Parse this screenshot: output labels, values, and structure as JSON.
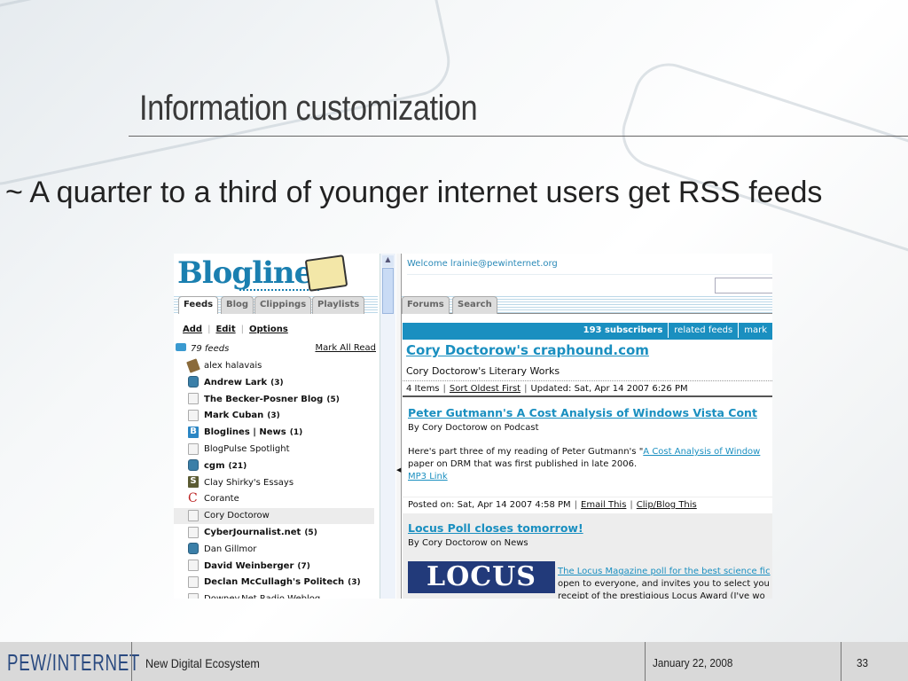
{
  "slide": {
    "title": "Information customization",
    "bullet": "~ A quarter to a third of younger internet users get RSS feeds"
  },
  "bloglines": {
    "logo": "Bloglines",
    "left_tabs": [
      "Feeds",
      "Blog",
      "Clippings",
      "Playlists"
    ],
    "actions": [
      "Add",
      "Edit",
      "Options"
    ],
    "feed_count": "79 feeds",
    "mark_all_read": "Mark All Read",
    "feeds": [
      {
        "name": "alex halavais",
        "count": "",
        "icon": "avatar",
        "bold": false
      },
      {
        "name": "Andrew Lark",
        "count": "(3)",
        "icon": "bubble",
        "bold": true
      },
      {
        "name": "The Becker-Posner Blog",
        "count": "(5)",
        "icon": "page",
        "bold": true
      },
      {
        "name": "Mark Cuban",
        "count": "(3)",
        "icon": "page",
        "bold": true
      },
      {
        "name": "Bloglines | News",
        "count": "(1)",
        "icon": "b",
        "bold": true
      },
      {
        "name": "BlogPulse Spotlight",
        "count": "",
        "icon": "page",
        "bold": false
      },
      {
        "name": "cgm",
        "count": "(21)",
        "icon": "bubble",
        "bold": true
      },
      {
        "name": "Clay Shirky's Essays",
        "count": "",
        "icon": "s",
        "bold": false
      },
      {
        "name": "Corante",
        "count": "",
        "icon": "c",
        "bold": false
      },
      {
        "name": "Cory Doctorow",
        "count": "",
        "icon": "page",
        "bold": false,
        "selected": true
      },
      {
        "name": "CyberJournalist.net",
        "count": "(5)",
        "icon": "page",
        "bold": true
      },
      {
        "name": "Dan Gillmor",
        "count": "",
        "icon": "bubble",
        "bold": false
      },
      {
        "name": "David Weinberger",
        "count": "(7)",
        "icon": "page",
        "bold": true
      },
      {
        "name": "Declan McCullagh's Politech",
        "count": "(3)",
        "icon": "page",
        "bold": true
      },
      {
        "name": "Downey.Net Radio Weblog",
        "count": "",
        "icon": "page",
        "bold": false
      }
    ],
    "welcome": "Welcome lrainie@pewinternet.org",
    "right_tabs": [
      "Forums",
      "Search"
    ],
    "bar_items": [
      "193 subscribers",
      "related feeds",
      "mark"
    ],
    "feed_title": "Cory Doctorow's craphound.com",
    "feed_subtitle": "Cory Doctorow's Literary Works",
    "meta": {
      "items": "4 Items",
      "sort": "Sort Oldest First",
      "updated": "Updated: Sat, Apr 14 2007 6:26 PM"
    },
    "item1": {
      "title": "Peter Gutmann's A Cost Analysis of Windows Vista Cont",
      "by": "By Cory Doctorow on Podcast",
      "body_pre": "Here's part three of my reading of Peter Gutmann's \"",
      "body_link": "A Cost Analysis of Window",
      "body_line2": "paper on DRM that was first published in late 2006.",
      "mp3": "MP3 Link",
      "posted": "Posted on: Sat, Apr 14 2007 4:58 PM",
      "email": "Email This",
      "clip": "Clip/Blog This"
    },
    "item2": {
      "title": "Locus Poll closes tomorrow!",
      "by": "By Cory Doctorow on News",
      "image_text": "LOCUS",
      "line1": "The Locus Magazine poll for the best science fic",
      "line2": "open to everyone, and invites you to select you",
      "line3": "receipt of the prestigious Locus Award (I've wo"
    }
  },
  "footer": {
    "logo": "PEW/INTERNET",
    "title": "New Digital Ecosystem",
    "date": "January 22, 2008",
    "page": "33"
  }
}
